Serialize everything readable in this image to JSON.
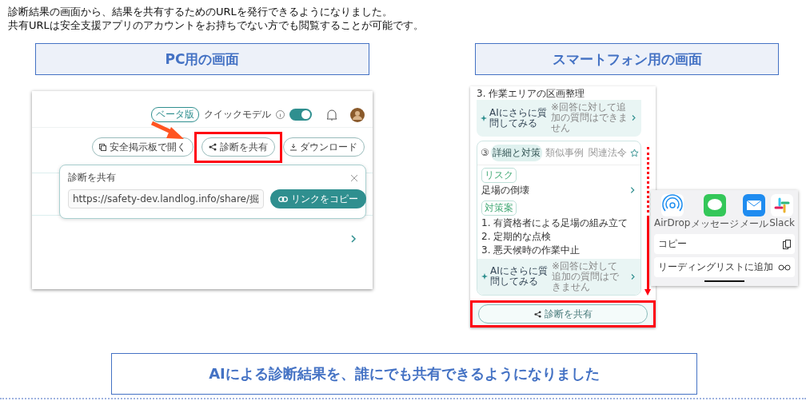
{
  "intro": [
    "診断結果の画面から、結果を共有するためのURLを発行できるようになりました。",
    "共有URLは安全支援アプリのアカウントをお持ちでない方でも閲覧することが可能です。"
  ],
  "pc": {
    "heading": "PC用の画面",
    "header": {
      "beta_badge": "ベータ版",
      "quick_mode_label": "クイックモデル",
      "quick_mode_on": true
    },
    "actions": [
      {
        "label": "安全掲示板で開く",
        "kind": "open",
        "highlighted": false
      },
      {
        "label": "診断を共有",
        "kind": "share",
        "highlighted": true
      },
      {
        "label": "ダウンロード",
        "kind": "download",
        "highlighted": false
      }
    ],
    "share_popup": {
      "title": "診断を共有",
      "url": "https://safety-dev.landlog.info/share/掘",
      "copy_button": "リンクをコピー"
    }
  },
  "mobile": {
    "heading": "スマートフォン用の画面",
    "prev_item": "3. 作業エリアの区画整理",
    "prev_ask": {
      "label": "AIにさらに質問してみる",
      "note": "※回答に対して追加の質問はできません"
    },
    "card": {
      "number": "③",
      "starred": false,
      "tabs": [
        {
          "label": "詳細と対策",
          "selected": true
        },
        {
          "label": "類似事例",
          "selected": false
        },
        {
          "label": "関連法令",
          "selected": false
        }
      ],
      "risk_tag": "リスク",
      "risk": "足場の倒壊",
      "measures_tag": "対策案",
      "measures": [
        "1. 有資格者による足場の組み立て",
        "2. 定期的な点検",
        "3. 悪天候時の作業中止"
      ],
      "ask": {
        "label": "AIにさらに質問してみる",
        "note": "※回答に対して追加の質問はできません"
      }
    },
    "share_button": {
      "label": "診断を共有",
      "highlighted": true
    },
    "share_sheet": {
      "apps": [
        {
          "label": "AirDrop",
          "kind": "airdrop"
        },
        {
          "label": "メッセージ",
          "kind": "messages"
        },
        {
          "label": "メール",
          "kind": "mail"
        },
        {
          "label": "Slack",
          "kind": "slack"
        }
      ],
      "actions": [
        {
          "label": "コピー",
          "kind": "copy"
        },
        {
          "label": "リーディングリストに追加",
          "kind": "reading"
        }
      ]
    }
  },
  "summary": "AIによる診断結果を、誰にでも共有できるようになりました"
}
